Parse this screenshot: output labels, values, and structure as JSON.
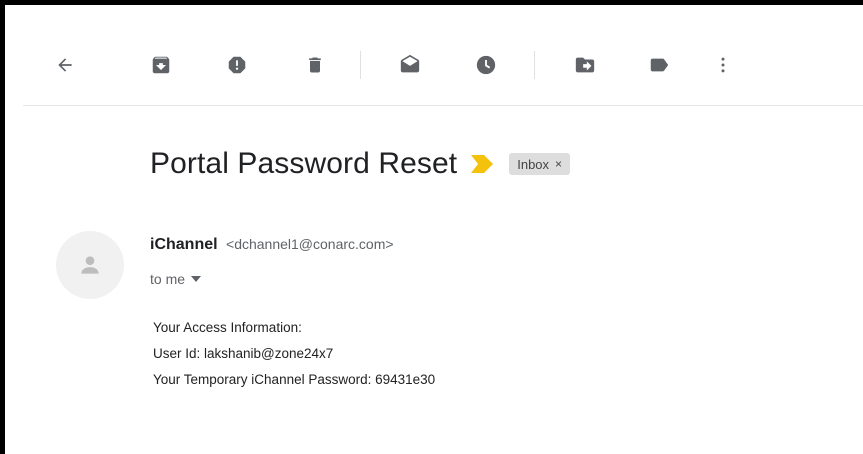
{
  "toolbar": {
    "back": "back-arrow-icon",
    "archive": "archive-icon",
    "spam": "report-spam-icon",
    "delete": "delete-icon",
    "mark_unread": "mark-unread-icon",
    "snooze": "snooze-icon",
    "move_to": "move-to-icon",
    "labels": "label-icon",
    "more": "more-vert-icon"
  },
  "email": {
    "subject": "Portal Password Reset",
    "label": "Inbox",
    "label_remove": "×",
    "sender_name": "iChannel",
    "sender_email": "<dchannel1@conarc.com>",
    "recipient": "to me",
    "body": [
      "Your Access Information:",
      "User Id: lakshanib@zone24x7",
      "Your Temporary iChannel Password: 69431e30"
    ]
  },
  "colors": {
    "icon_gray": "#5f6368",
    "importance_yellow": "#f4c20d",
    "chip_bg": "#dddddd"
  }
}
